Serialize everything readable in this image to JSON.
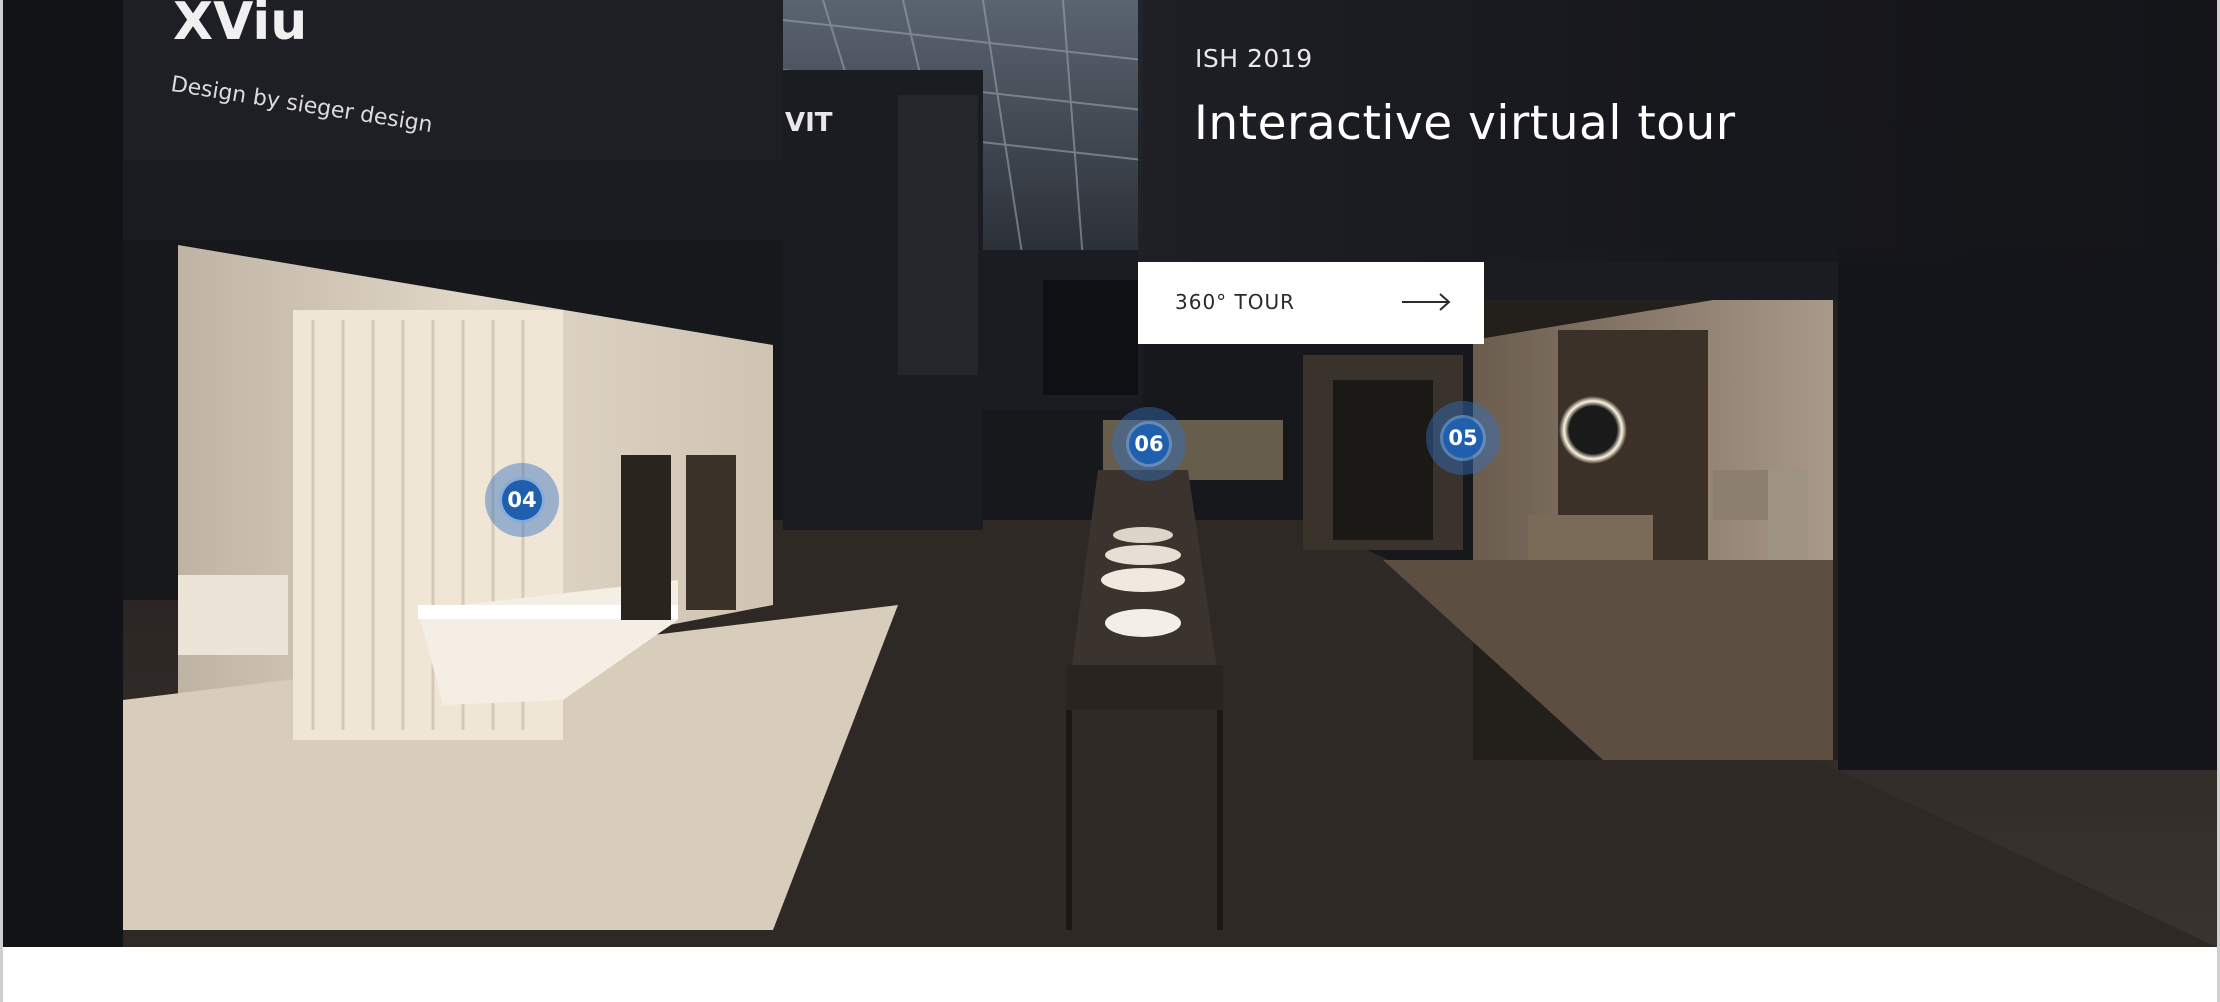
{
  "hero": {
    "eyebrow": "ISH 2019",
    "headline": "Interactive virtual tour",
    "cta_label": "360° TOUR",
    "cta_icon": "arrow-right-icon",
    "signage": {
      "brand": "XViu",
      "tagline": "Design by sieger design",
      "wall_brand": "VIT"
    }
  },
  "hotspots": [
    {
      "number": "04"
    },
    {
      "number": "06"
    },
    {
      "number": "05"
    }
  ],
  "colors": {
    "hotspot_fill": "#1f5fae",
    "panel_text": "#ffffff",
    "button_bg": "#ffffff"
  }
}
